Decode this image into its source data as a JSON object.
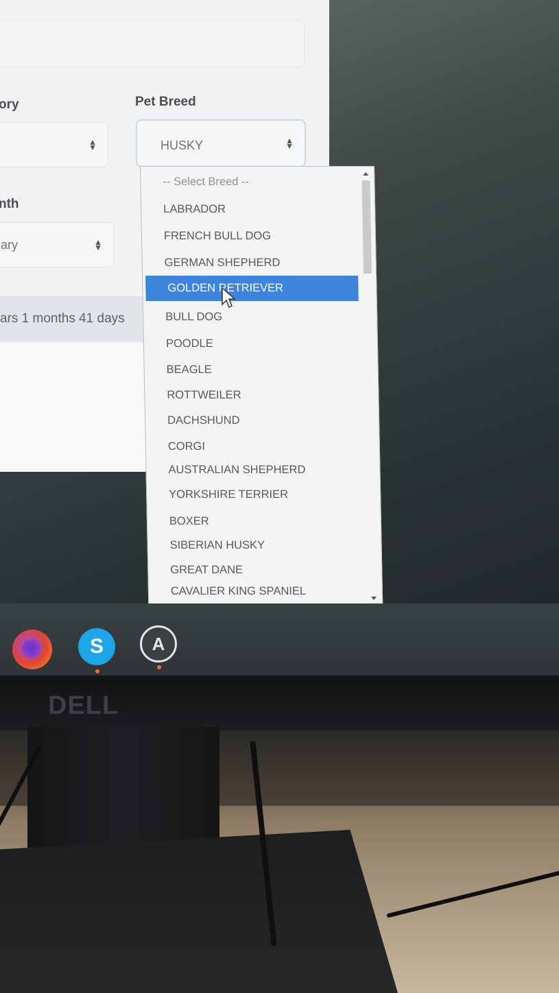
{
  "form": {
    "category_label_partial": "ory",
    "breed_label": "Pet Breed",
    "breed_value": "HUSKY",
    "month_label_partial": "nth",
    "month_value_partial": "ary",
    "age_text_partial": "ars 1 months 41 days"
  },
  "dropdown": {
    "placeholder": "-- Select Breed --",
    "options": [
      "LABRADOR",
      "FRENCH BULL DOG",
      "GERMAN SHEPHERD",
      "GOLDEN RETRIEVER",
      "BULL DOG",
      "POODLE",
      "BEAGLE",
      "ROTTWEILER",
      "DACHSHUND",
      "CORGI",
      "AUSTRALIAN SHEPHERD",
      "YORKSHIRE TERRIER",
      "BOXER",
      "SIBERIAN HUSKY",
      "GREAT DANE",
      "CAVALIER KING SPANIEL"
    ],
    "highlighted": "GOLDEN RETRIEVER"
  },
  "taskbar": {
    "icons": [
      "firefox-icon",
      "skype-icon",
      "app-a-icon"
    ],
    "skype_glyph": "S",
    "app3_glyph": "A"
  },
  "monitor": {
    "brand": "DELL"
  },
  "colors": {
    "highlight": "#3d84dc"
  }
}
